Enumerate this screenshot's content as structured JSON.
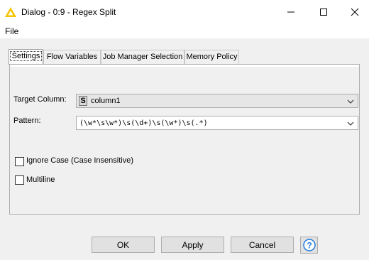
{
  "window": {
    "title": "Dialog - 0:9 - Regex Split"
  },
  "menu": {
    "file": "File"
  },
  "tabs": [
    "Settings",
    "Flow Variables",
    "Job Manager Selection",
    "Memory Policy"
  ],
  "settings": {
    "target_column_label": "Target Column:",
    "target_column_type": "S",
    "target_column_value": "column1",
    "pattern_label": "Pattern:",
    "pattern_value": "(\\w*\\s\\w*)\\s(\\d+)\\s(\\w*)\\s(.*)",
    "ignore_case_label": "Ignore Case (Case Insensitive)",
    "ignore_case_checked": false,
    "multiline_label": "Multiline",
    "multiline_checked": false
  },
  "buttons": {
    "ok": "OK",
    "apply": "Apply",
    "cancel": "Cancel"
  },
  "colors": {
    "title_icon": "#f5c400",
    "help_icon": "#1e7be0"
  }
}
